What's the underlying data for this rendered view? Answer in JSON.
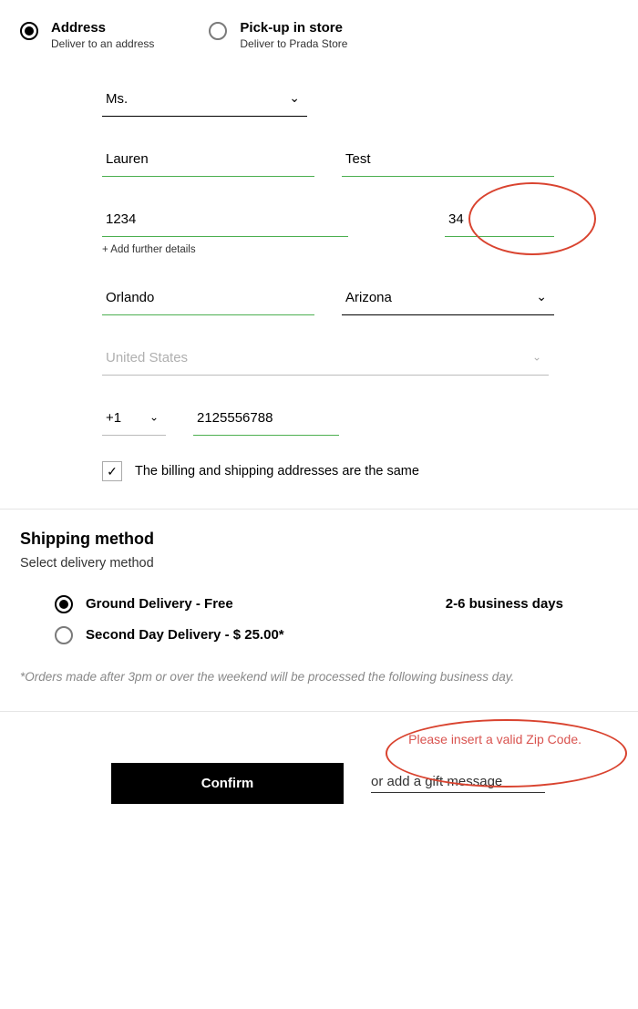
{
  "delivery": {
    "options": [
      {
        "title": "Address",
        "subtitle": "Deliver to an address",
        "selected": true
      },
      {
        "title": "Pick-up in store",
        "subtitle": "Deliver to Prada Store",
        "selected": false
      }
    ]
  },
  "form": {
    "title": "Ms.",
    "first_name": "Lauren",
    "last_name": "Test",
    "street": "1234",
    "street_number": "34",
    "add_details": "+ Add further details",
    "city": "Orlando",
    "state": "Arizona",
    "country": "United States",
    "phone_cc": "+1",
    "phone": "2125556788",
    "same_billing_checked": true,
    "same_billing_label": "The billing and shipping addresses are the same"
  },
  "shipping": {
    "heading": "Shipping method",
    "subheading": "Select delivery method",
    "options": [
      {
        "label": "Ground Delivery - Free",
        "eta": "2-6 business days",
        "selected": true
      },
      {
        "label": "Second Day Delivery - $ 25.00*",
        "eta": "",
        "selected": false
      }
    ],
    "note": "*Orders made after 3pm or over the weekend will be processed the following business day."
  },
  "confirm": {
    "error": "Please insert a valid Zip Code.",
    "button": "Confirm",
    "gift_link": "or add a gift message"
  }
}
